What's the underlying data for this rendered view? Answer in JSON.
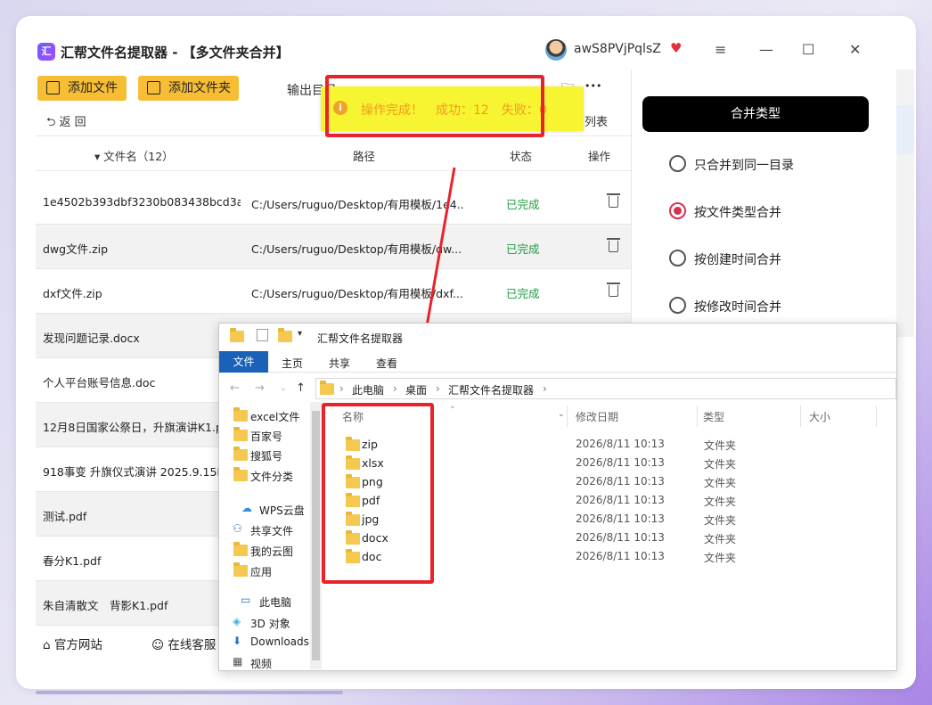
{
  "app": {
    "logo_text": "汇",
    "title": "汇帮文件名提取器 - 【多文件夹合并】",
    "user": "awS8PVjPqlsZ",
    "menu_glyph": "≡",
    "min_glyph": "—",
    "max_glyph": "☐",
    "close_glyph": "✕"
  },
  "toolbar": {
    "add_file": "添加文件",
    "add_folder": "添加文件夹",
    "output_label": "输出目录",
    "more_glyph": "•••"
  },
  "nav": {
    "back": "返 回",
    "list": "列表"
  },
  "table": {
    "headers": {
      "name": "▾ 文件名（12）",
      "path": "路径",
      "status": "状态",
      "action": "操作"
    },
    "rows": [
      {
        "name": "1e4502b393dbf3230b083438bcd3ac...",
        "path": "C:/Users/ruguo/Desktop/有用模板/1e4...",
        "status": "已完成"
      },
      {
        "name": "dwg文件.zip",
        "path": "C:/Users/ruguo/Desktop/有用模板/dw...",
        "status": "已完成"
      },
      {
        "name": "dxf文件.zip",
        "path": "C:/Users/ruguo/Desktop/有用模板/dxf...",
        "status": "已完成"
      },
      {
        "name": "发现问题记录.docx",
        "path": "",
        "status": ""
      },
      {
        "name": "个人平台账号信息.doc",
        "path": "",
        "status": ""
      },
      {
        "name": "12月8日国家公祭日，升旗演讲K1.pd",
        "path": "",
        "status": ""
      },
      {
        "name": "918事变 升旗仪式演讲 2025.9.15K1.",
        "path": "",
        "status": ""
      },
      {
        "name": "测试.pdf",
        "path": "",
        "status": ""
      },
      {
        "name": "春分K1.pdf",
        "path": "",
        "status": ""
      },
      {
        "name": "朱自清散文　背影K1.pdf",
        "path": "",
        "status": ""
      }
    ]
  },
  "footer": {
    "site": "官方网站",
    "service": "在线客服"
  },
  "merge": {
    "header": "合并类型",
    "options": [
      "只合并到同一目录",
      "按文件类型合并",
      "按创建时间合并",
      "按修改时间合并"
    ],
    "selected_index": 1,
    "accent": "#d3334d"
  },
  "toast": {
    "icon": "i",
    "text": "操作完成！　成功：12　失败：0"
  },
  "explorer": {
    "title": "汇帮文件名提取器",
    "tabs": [
      "文件",
      "主页",
      "共享",
      "查看"
    ],
    "crumbs": [
      "此电脑",
      "桌面",
      "汇帮文件名提取器"
    ],
    "tree": [
      "excel文件",
      "百家号",
      "搜狐号",
      "文件分类",
      "WPS云盘",
      "共享文件",
      "我的云图",
      "应用",
      "此电脑",
      "3D 对象",
      "Downloads",
      "视频"
    ],
    "columns": {
      "name": "名称",
      "date": "修改日期",
      "type": "类型",
      "size": "大小"
    },
    "files": [
      {
        "name": "zip",
        "date": "2026/8/11 10:13",
        "type": "文件夹"
      },
      {
        "name": "xlsx",
        "date": "2026/8/11 10:13",
        "type": "文件夹"
      },
      {
        "name": "png",
        "date": "2026/8/11 10:13",
        "type": "文件夹"
      },
      {
        "name": "pdf",
        "date": "2026/8/11 10:13",
        "type": "文件夹"
      },
      {
        "name": "jpg",
        "date": "2026/8/11 10:13",
        "type": "文件夹"
      },
      {
        "name": "docx",
        "date": "2026/8/11 10:13",
        "type": "文件夹"
      },
      {
        "name": "doc",
        "date": "2026/8/11 10:13",
        "type": "文件夹"
      }
    ]
  },
  "colors": {
    "toolbar_button": "#f7bd34",
    "status_done": "#1a9c3c",
    "toast_bg": "#f7f431",
    "toast_text": "#f29b1f",
    "annotation": "#e8232a",
    "ribbon_active": "#1a62b8"
  }
}
